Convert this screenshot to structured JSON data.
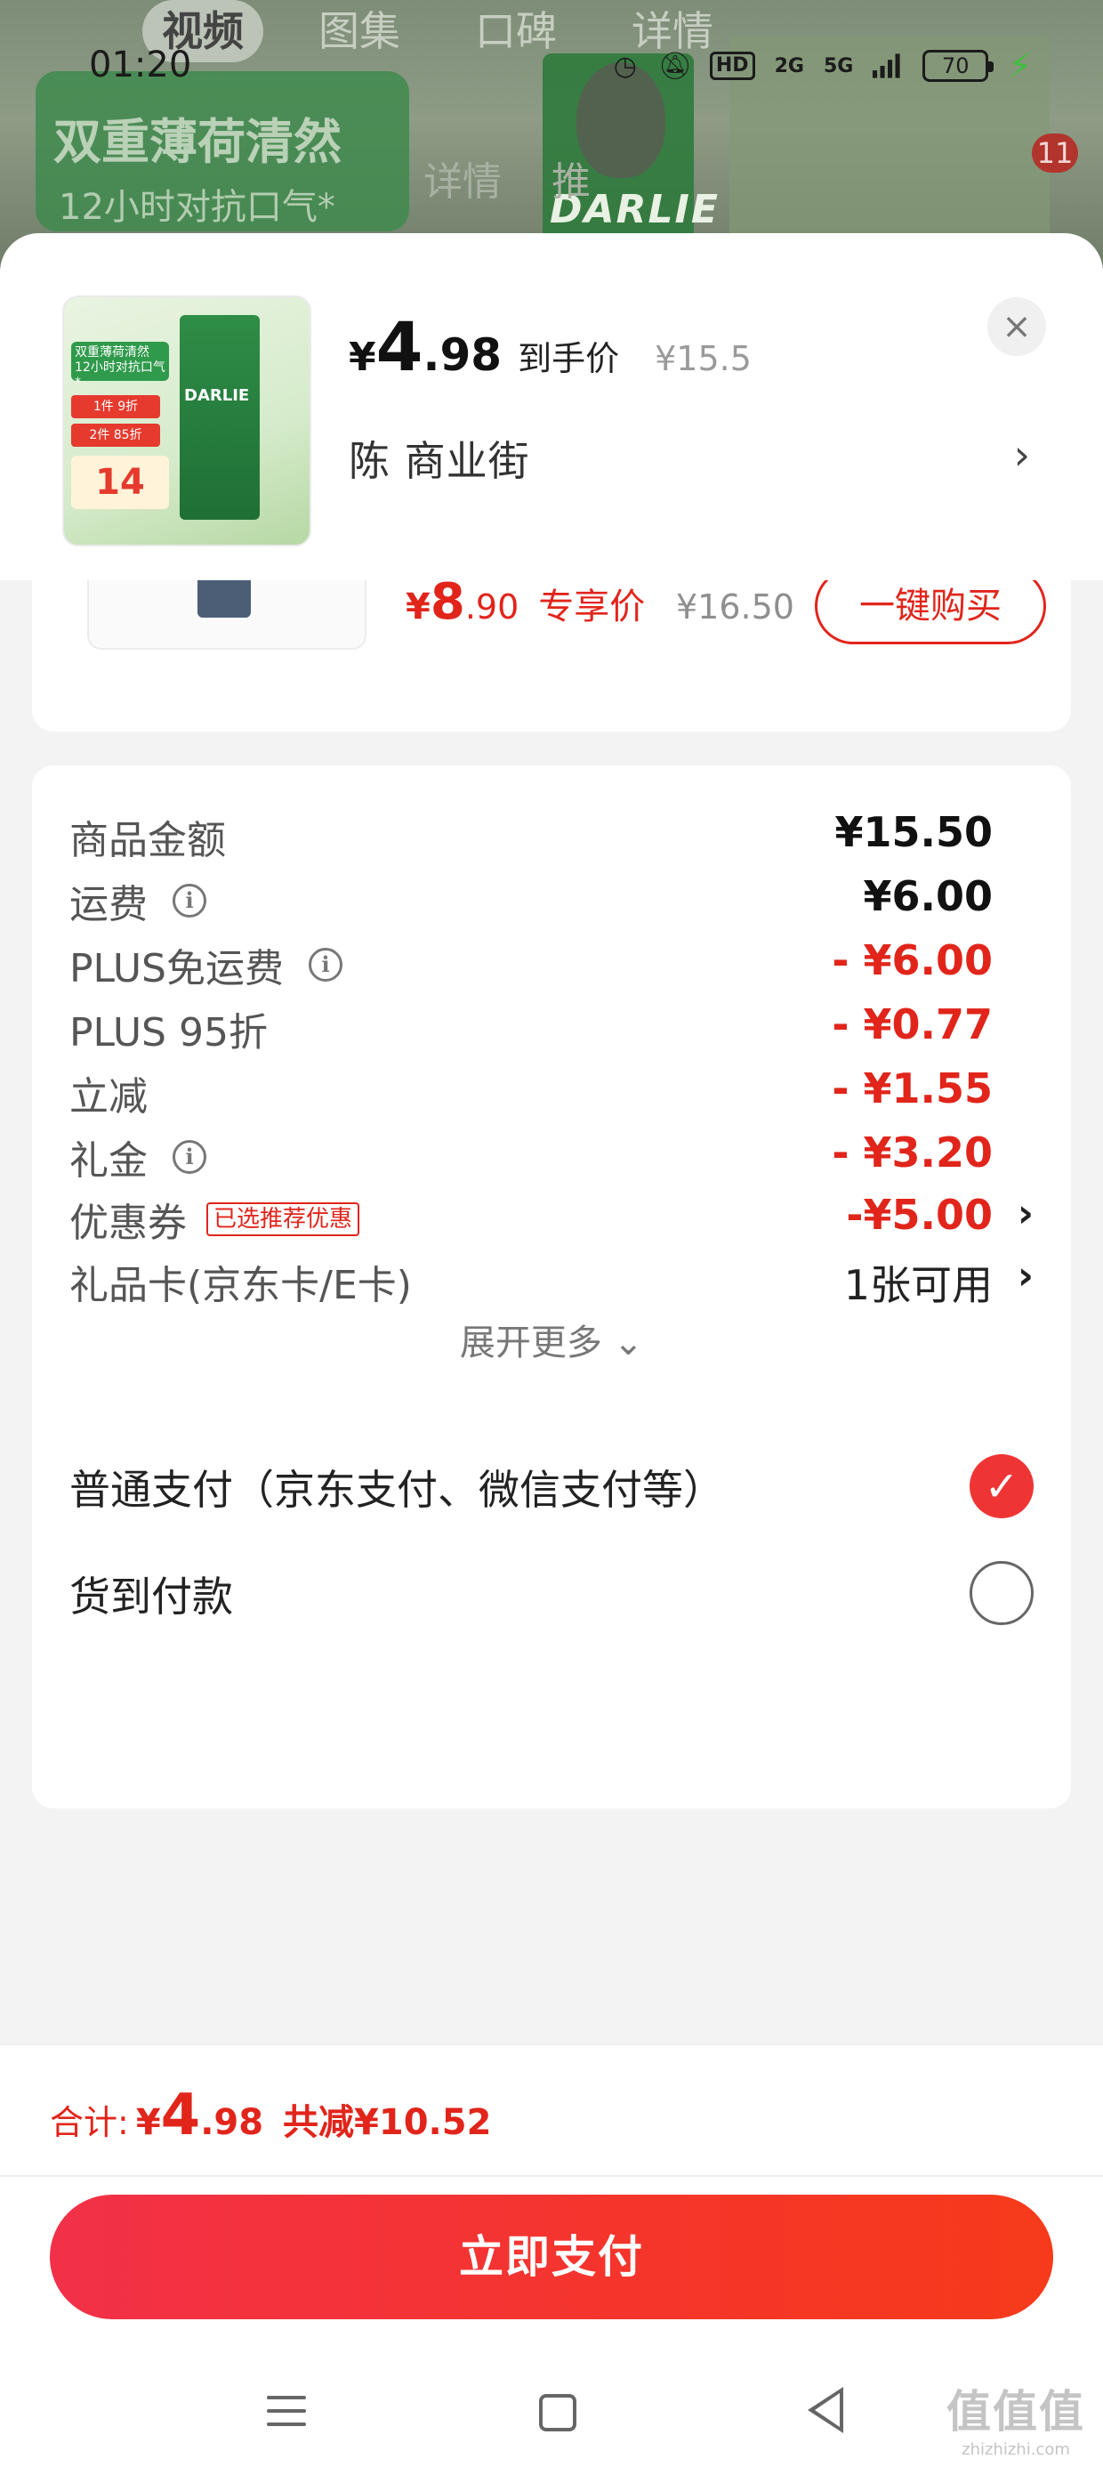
{
  "status_bar": {
    "time": "01:20",
    "network": "2G",
    "network2": "5G",
    "hd": "HD",
    "battery": "70"
  },
  "background": {
    "tabs": [
      "视频",
      "图集",
      "口碑",
      "详情"
    ],
    "active_tab": "视频",
    "banner_line1": "双重薄荷清然",
    "banner_line2": "12小时对抗口气*",
    "detail_label": "详情",
    "detail_label2": "推",
    "brand": "DARLIE",
    "cart_count": "11"
  },
  "header": {
    "price_currency": "¥",
    "price_int": "4",
    "price_dec": ".98",
    "price_label": "到手价",
    "original_price": "¥15.5",
    "seller": "陈  商业街",
    "close_icon": "×",
    "thumb": {
      "tag1": "双重薄荷清然 12小时对抗口气*",
      "tag2": "1件 9折",
      "tag3": "2件 85折",
      "num": "14",
      "brand": "DARLIE"
    }
  },
  "recommendation": {
    "price_currency": "¥",
    "price_int": "8",
    "price_dec": ".90",
    "price_label": "专享价",
    "original_price": "¥16.50",
    "buy_button": "一键购买"
  },
  "fees": [
    {
      "label": "商品金额",
      "value": "¥15.50",
      "info": false,
      "style": "normal"
    },
    {
      "label": "运费",
      "value": "¥6.00",
      "info": true,
      "style": "normal"
    },
    {
      "label": "PLUS免运费",
      "value": "- ¥6.00",
      "info": true,
      "style": "red"
    },
    {
      "label": "PLUS 95折",
      "value": "- ¥0.77",
      "info": false,
      "style": "red"
    },
    {
      "label": "立减",
      "value": "- ¥1.55",
      "info": false,
      "style": "red"
    },
    {
      "label": "礼金",
      "value": "- ¥3.20",
      "info": true,
      "style": "red"
    },
    {
      "label": "优惠券",
      "value": "-¥5.00",
      "tag": "已选推荐优惠",
      "chevron": true,
      "style": "red"
    },
    {
      "label": "礼品卡(京东卡/E卡)",
      "value": "1张可用",
      "chevron": true,
      "style": "plain"
    }
  ],
  "expand_label": "展开更多 ⌄",
  "payment": {
    "options": [
      {
        "label": "普通支付（京东支付、微信支付等）",
        "selected": true
      },
      {
        "label": "货到付款",
        "selected": false
      }
    ]
  },
  "footer": {
    "total_label": "合计:",
    "total_currency": "¥",
    "total_int": "4",
    "total_dec": ".98",
    "total_saved": "共减¥10.52",
    "pay_button": "立即支付"
  },
  "watermark": {
    "logo": "值值值",
    "text": "zhizhizhi.com"
  },
  "colors": {
    "accent_red": "#e1251b",
    "button_gradient_start": "#f23048",
    "button_gradient_end": "#f63a1b"
  }
}
